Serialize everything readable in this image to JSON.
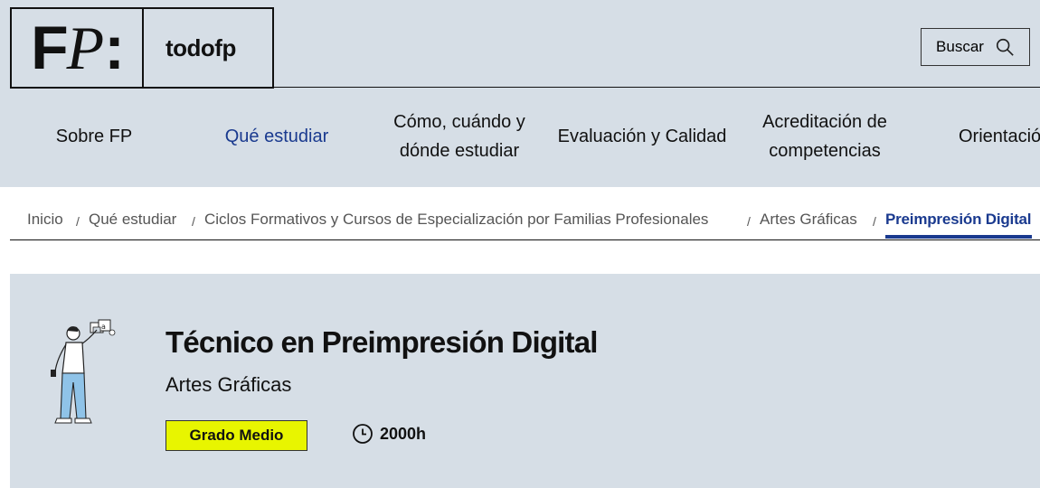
{
  "header": {
    "logo_mark": "FP:",
    "logo_text": "todofp",
    "search_label": "Buscar"
  },
  "nav": [
    {
      "label": "Sobre FP"
    },
    {
      "label": "Qué estudiar"
    },
    {
      "label": "Cómo, cuándo y dónde estudiar"
    },
    {
      "label": "Evaluación y Calidad"
    },
    {
      "label": "Acreditación de competencias"
    },
    {
      "label": "Orientación"
    }
  ],
  "breadcrumb": [
    {
      "label": "Inicio"
    },
    {
      "label": "Qué estudiar"
    },
    {
      "label": "Ciclos Formativos y Cursos de Especialización por Familias Profesionales"
    },
    {
      "label": "Artes Gráficas"
    },
    {
      "label": "Preimpresión Digital"
    }
  ],
  "breadcrumb_separator": "/",
  "course": {
    "title": "Técnico en Preimpresión Digital",
    "family": "Artes Gráficas",
    "level": "Grado Medio",
    "hours": "2000h"
  },
  "icons": {
    "search": "search-icon",
    "clock": "clock-icon",
    "illustration": "person-holding-prints-illustration"
  },
  "colors": {
    "header_bg": "#d6dee6",
    "accent": "#1a3a8f",
    "badge_bg": "#e8f500"
  }
}
